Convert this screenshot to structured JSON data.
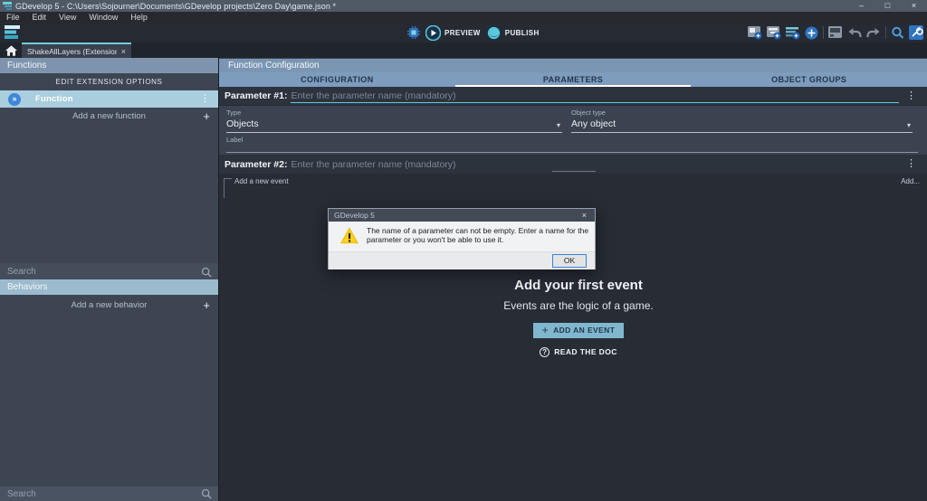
{
  "window": {
    "title": "GDevelop 5 - C:\\Users\\Sojourner\\Documents\\GDevelop projects\\Zero Day\\game.json *",
    "controls": {
      "minimize": "–",
      "maximize": "□",
      "close": "×"
    }
  },
  "menubar": {
    "items": [
      "File",
      "Edit",
      "View",
      "Window",
      "Help"
    ]
  },
  "toolbar": {
    "preview_label": "PREVIEW",
    "publish_label": "PUBLISH"
  },
  "tabs": {
    "active_label": "ShakeAllLayers (Extension)",
    "close_glyph": "×"
  },
  "sidebar": {
    "functions_header": "Functions",
    "edit_options_label": "EDIT EXTENSION OPTIONS",
    "function_item": "Function",
    "add_function_label": "Add a new function",
    "search_placeholder": "Search",
    "behaviors_header": "Behaviors",
    "add_behavior_label": "Add a new behavior",
    "bottom_search_placeholder": "Search"
  },
  "main": {
    "header": "Function Configuration",
    "tabs": [
      "CONFIGURATION",
      "PARAMETERS",
      "OBJECT GROUPS"
    ],
    "active_tab": "PARAMETERS",
    "param1": {
      "label": "Parameter #1:",
      "placeholder": "Enter the parameter name (mandatory)",
      "type_label": "Type",
      "type_value": "Objects",
      "object_type_label": "Object type",
      "object_type_value": "Any object",
      "field_label": "Label"
    },
    "param2": {
      "label": "Parameter #2:",
      "placeholder": "Enter the parameter name (mandatory)"
    },
    "events": {
      "add_new_event": "Add a new event",
      "add_more": "Add...",
      "empty_title": "Add your first event",
      "empty_desc": "Events are the logic of a game.",
      "add_event_button": "ADD AN EVENT",
      "read_doc_label": "READ THE DOC"
    }
  },
  "dialog": {
    "title": "GDevelop 5",
    "message": "The name of a parameter can not be empty. Enter a name for the parameter or you won't be able to use it.",
    "ok_label": "OK"
  },
  "icons": {
    "kebab_glyph": "⋮",
    "plus_glyph": "+",
    "function_glyph": "»",
    "dropdown_glyph": "▾",
    "question_glyph": "?"
  },
  "colors": {
    "accent_cyan": "#62c8ea",
    "tab_indicator_teal": "#6fd0dd",
    "selection_blue": "#a9cede",
    "header_blue": "#7e9cbd",
    "add_event_button": "#80b7cf",
    "warning_yellow": "#ffd21e",
    "ok_focus_border": "#3f81d6"
  }
}
